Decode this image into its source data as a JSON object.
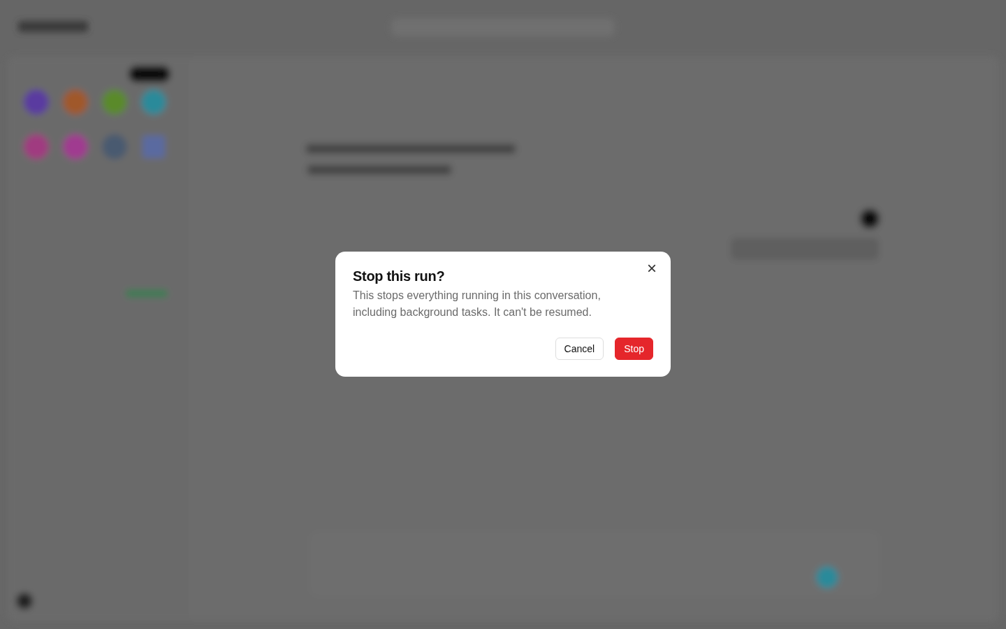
{
  "dialog": {
    "title": "Stop this run?",
    "message": "This stops everything running in this conversation, including background tasks. It can't be resumed.",
    "close": {
      "label": "×"
    },
    "buttons": [
      {
        "label": "Cancel",
        "kind": "secondary"
      },
      {
        "label": "Stop",
        "kind": "danger"
      }
    ]
  }
}
